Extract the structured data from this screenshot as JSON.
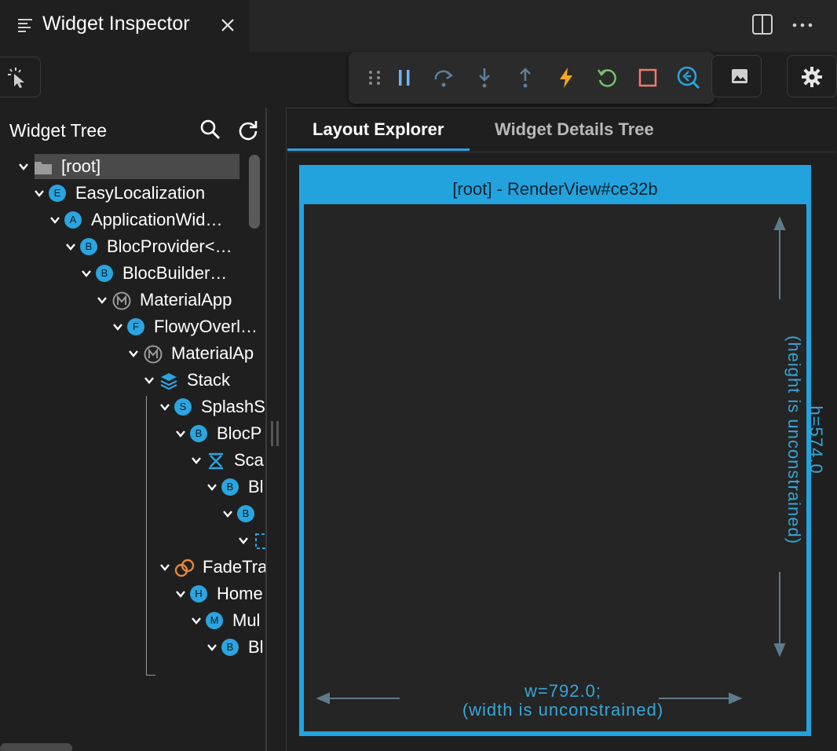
{
  "window": {
    "tab_title": "Widget Inspector",
    "icons": [
      "list-icon",
      "close-icon",
      "split-editor-icon",
      "more-icon"
    ]
  },
  "toolbar": {
    "select_mode_icon": "pointer-select-icon",
    "debug_buttons": [
      "drag-handle-icon",
      "pause-icon",
      "step-over-icon",
      "step-into-icon",
      "step-out-icon",
      "hot-reload-icon",
      "hot-restart-icon",
      "stop-icon",
      "flutter-inspector-icon"
    ],
    "screenshot_icon": "image-icon",
    "settings_icon": "gear-icon"
  },
  "tree": {
    "header_title": "Widget Tree",
    "nodes": [
      {
        "label": "[root]",
        "icon": "folder",
        "level": 0,
        "selected": true
      },
      {
        "label": "EasyLocalization",
        "icon": "badge",
        "letter": "E",
        "level": 1
      },
      {
        "label": "ApplicationWid…",
        "icon": "badge",
        "letter": "A",
        "level": 2
      },
      {
        "label": "BlocProvider<…",
        "icon": "badge",
        "letter": "B",
        "level": 3
      },
      {
        "label": "BlocBuilder…",
        "icon": "badge",
        "letter": "B",
        "level": 4
      },
      {
        "label": "MaterialApp",
        "icon": "material",
        "level": 5
      },
      {
        "label": "FlowyOverl…",
        "icon": "badge",
        "letter": "F",
        "level": 6
      },
      {
        "label": "MaterialAp",
        "icon": "material",
        "level": 7
      },
      {
        "label": "Stack",
        "icon": "stack",
        "level": 8
      },
      {
        "label": "SplashS",
        "icon": "badge",
        "letter": "S",
        "level": 9
      },
      {
        "label": "BlocP",
        "icon": "badge",
        "letter": "B",
        "level": 10
      },
      {
        "label": "Sca",
        "icon": "scaffold",
        "level": 11
      },
      {
        "label": "Bl",
        "icon": "badge",
        "letter": "B",
        "level": 12
      },
      {
        "label": "",
        "icon": "badge",
        "letter": "B",
        "level": 13
      },
      {
        "label": "",
        "icon": "dashed",
        "level": 14
      },
      {
        "label": "FadeTra",
        "icon": "transition",
        "level": 9
      },
      {
        "label": "Home",
        "icon": "badge",
        "letter": "H",
        "level": 10
      },
      {
        "label": "Mul",
        "icon": "badge",
        "letter": "M",
        "level": 11
      },
      {
        "label": "Bl",
        "icon": "badge",
        "letter": "B",
        "level": 12
      }
    ]
  },
  "inspector": {
    "tabs": [
      {
        "label": "Layout Explorer",
        "active": true
      },
      {
        "label": "Widget Details Tree",
        "active": false
      }
    ],
    "render_title": "[root] - RenderView#ce32b",
    "width_line1": "w=792.0;",
    "width_line2": "(width is unconstrained)",
    "height_line1": "h=574.0",
    "height_line2": "(height is unconstrained)",
    "accent_color": "#22a3dd"
  }
}
